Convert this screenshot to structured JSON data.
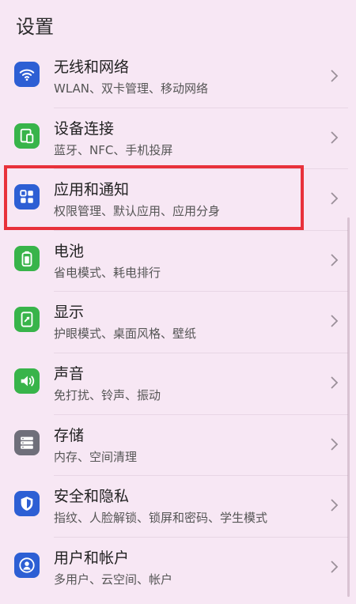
{
  "header": {
    "title": "设置"
  },
  "items": [
    {
      "title": "无线和网络",
      "subtitle": "WLAN、双卡管理、移动网络",
      "icon": "wifi-icon",
      "color": "#2d5fd4"
    },
    {
      "title": "设备连接",
      "subtitle": "蓝牙、NFC、手机投屏",
      "icon": "device-connect-icon",
      "color": "#38b44a"
    },
    {
      "title": "应用和通知",
      "subtitle": "权限管理、默认应用、应用分身",
      "icon": "apps-grid-icon",
      "color": "#2d5fd4"
    },
    {
      "title": "电池",
      "subtitle": "省电模式、耗电排行",
      "icon": "battery-icon",
      "color": "#38b44a"
    },
    {
      "title": "显示",
      "subtitle": "护眼模式、桌面风格、壁纸",
      "icon": "display-icon",
      "color": "#38b44a"
    },
    {
      "title": "声音",
      "subtitle": "免打扰、铃声、振动",
      "icon": "sound-icon",
      "color": "#38b44a"
    },
    {
      "title": "存储",
      "subtitle": "内存、空间清理",
      "icon": "storage-icon",
      "color": "#6f6f7a"
    },
    {
      "title": "安全和隐私",
      "subtitle": "指纹、人脸解锁、锁屏和密码、学生模式",
      "icon": "shield-icon",
      "color": "#2d5fd4"
    },
    {
      "title": "用户和帐户",
      "subtitle": "多用户、云空间、帐户",
      "icon": "user-icon",
      "color": "#2d5fd4"
    }
  ],
  "highlight_color": "#e8313b",
  "highlighted_item": "应用和通知"
}
